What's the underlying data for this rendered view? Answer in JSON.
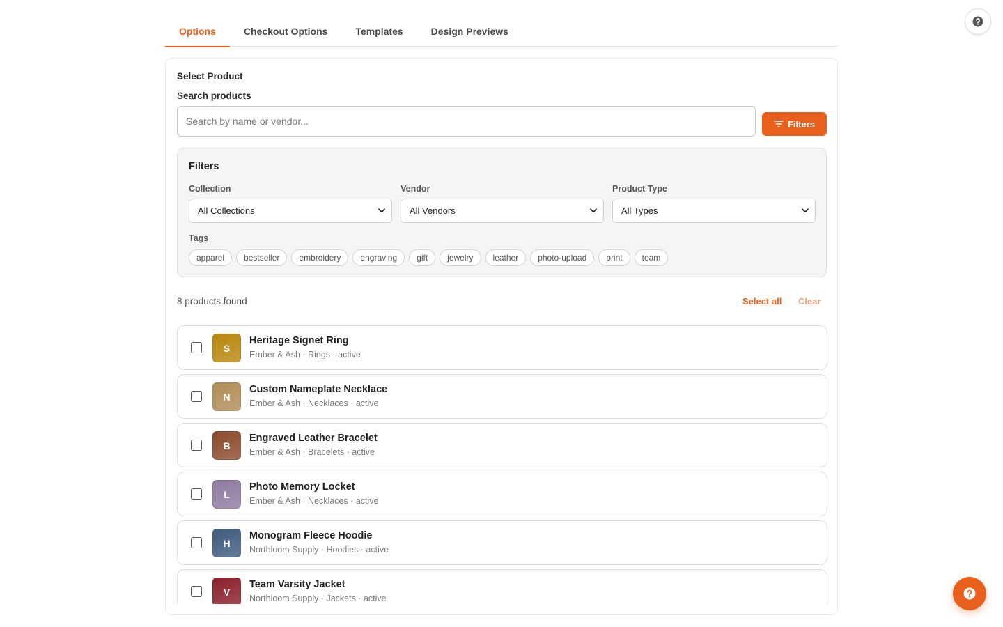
{
  "tabs": [
    {
      "label": "Options",
      "active": true
    },
    {
      "label": "Checkout Options",
      "active": false
    },
    {
      "label": "Templates",
      "active": false
    },
    {
      "label": "Design Previews",
      "active": false
    }
  ],
  "section_title": "Select Product",
  "search": {
    "label": "Search products",
    "placeholder": "Search by name or vendor...",
    "value": "",
    "filters_button": "Filters"
  },
  "filters": {
    "title": "Filters",
    "collection": {
      "label": "Collection",
      "value": "All Collections"
    },
    "vendor": {
      "label": "Vendor",
      "value": "All Vendors"
    },
    "product_type": {
      "label": "Product Type",
      "value": "All Types"
    },
    "tags_label": "Tags",
    "tags": [
      "apparel",
      "bestseller",
      "embroidery",
      "engraving",
      "gift",
      "jewelry",
      "leather",
      "photo-upload",
      "print",
      "team"
    ]
  },
  "results": {
    "count_text": "8 products found",
    "select_all": "Select all",
    "clear": "Clear"
  },
  "products": [
    {
      "initial": "S",
      "name": "Heritage Signet Ring",
      "meta": "Ember & Ash · Rings · active",
      "color": "#b8860b",
      "checked": false
    },
    {
      "initial": "N",
      "name": "Custom Nameplate Necklace",
      "meta": "Ember & Ash · Necklaces · active",
      "color": "#b08d57",
      "checked": false
    },
    {
      "initial": "B",
      "name": "Engraved Leather Bracelet",
      "meta": "Ember & Ash · Bracelets · active",
      "color": "#8b4a2b",
      "checked": false
    },
    {
      "initial": "L",
      "name": "Photo Memory Locket",
      "meta": "Ember & Ash · Necklaces · active",
      "color": "#8e7aa0",
      "checked": false
    },
    {
      "initial": "H",
      "name": "Monogram Fleece Hoodie",
      "meta": "Northloom Supply · Hoodies · active",
      "color": "#3e5a7e",
      "checked": false
    },
    {
      "initial": "V",
      "name": "Team Varsity Jacket",
      "meta": "Northloom Supply · Jackets · active",
      "color": "#8a1f2c",
      "checked": false
    }
  ],
  "icons": {
    "help_top": "question-circle-icon",
    "filters_btn": "filter-lines-icon",
    "fab": "question-circle-icon",
    "select_chevron": "chevron-down-icon"
  },
  "colors": {
    "accent": "#e8601c",
    "accent_light": "#f0a57e"
  }
}
